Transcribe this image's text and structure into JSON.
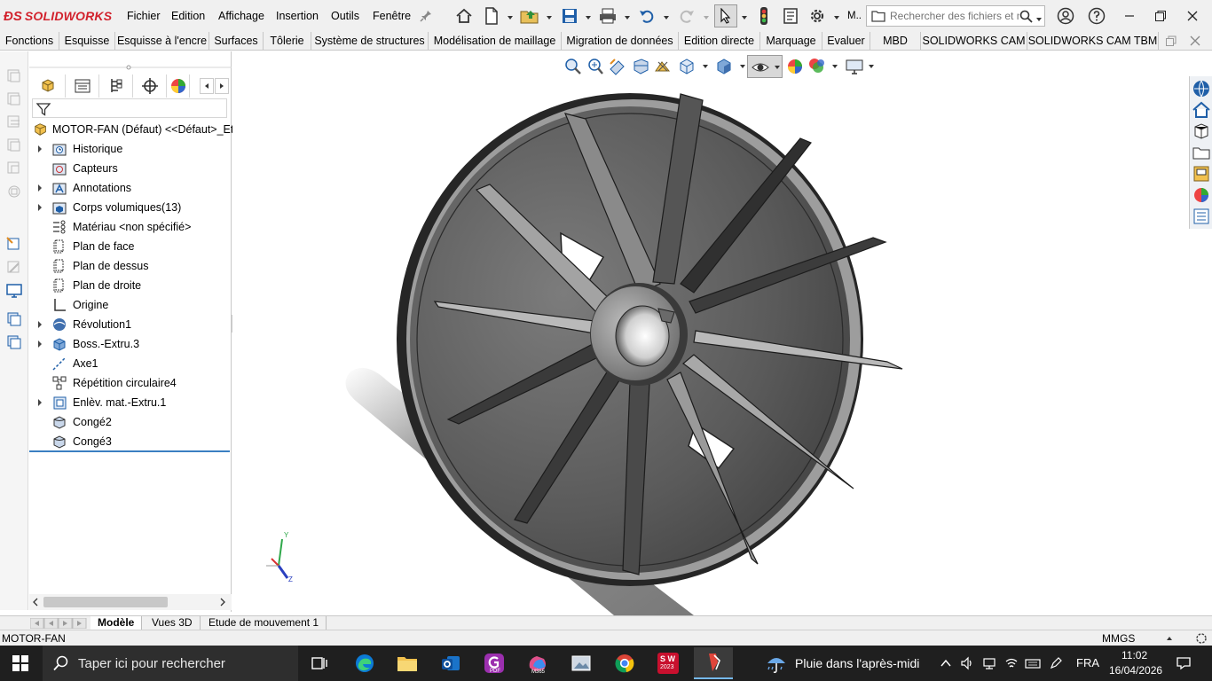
{
  "app": {
    "brand": "SOLIDWORKS",
    "brand_color": "#d2222d"
  },
  "menu": [
    "Fichier",
    "Edition",
    "Affichage",
    "Insertion",
    "Outils",
    "Fenêtre"
  ],
  "toolbar": {
    "user_abbrev": "M..",
    "search_placeholder": "Rechercher des fichiers et m"
  },
  "command_tabs": [
    "Fonctions",
    "Esquisse",
    "Esquisse à l'encre",
    "Surfaces",
    "Tôlerie",
    "Système de structures",
    "Modélisation de maillage",
    "Migration de données",
    "Edition directe",
    "Marquage",
    "Evaluer",
    "MBD",
    "SOLIDWORKS CAM",
    "SOLIDWORKS CAM TBM"
  ],
  "feature_tree": {
    "root": "MOTOR-FAN (Défaut) <<Défaut>_Etat",
    "items": [
      {
        "label": "Historique",
        "icon": "history-folder-icon",
        "expandable": true
      },
      {
        "label": "Capteurs",
        "icon": "sensor-icon",
        "expandable": false
      },
      {
        "label": "Annotations",
        "icon": "annotations-icon",
        "expandable": true
      },
      {
        "label": "Corps volumiques(13)",
        "icon": "solid-bodies-icon",
        "expandable": true
      },
      {
        "label": "Matériau <non spécifié>",
        "icon": "material-icon",
        "expandable": false
      },
      {
        "label": "Plan de face",
        "icon": "plane-icon",
        "expandable": false
      },
      {
        "label": "Plan de dessus",
        "icon": "plane-icon",
        "expandable": false
      },
      {
        "label": "Plan de droite",
        "icon": "plane-icon",
        "expandable": false
      },
      {
        "label": "Origine",
        "icon": "origin-icon",
        "expandable": false
      },
      {
        "label": "Révolution1",
        "icon": "revolve-icon",
        "expandable": true
      },
      {
        "label": "Boss.-Extru.3",
        "icon": "extrude-boss-icon",
        "expandable": true
      },
      {
        "label": "Axe1",
        "icon": "axis-icon",
        "expandable": false
      },
      {
        "label": "Répétition circulaire4",
        "icon": "circular-pattern-icon",
        "expandable": false
      },
      {
        "label": "Enlèv. mat.-Extru.1",
        "icon": "extrude-cut-icon",
        "expandable": true
      },
      {
        "label": "Congé2",
        "icon": "fillet-icon",
        "expandable": false
      },
      {
        "label": "Congé3",
        "icon": "fillet-icon",
        "expandable": false
      }
    ]
  },
  "triad": {
    "y": "Y",
    "z": "Z"
  },
  "bottom_tabs": [
    "Modèle",
    "Vues 3D",
    "Etude de mouvement 1"
  ],
  "status": {
    "left": "MOTOR-FAN",
    "units": "MMGS"
  },
  "taskbar": {
    "search_placeholder": "Taper ici pour rechercher",
    "weather": "Pluie dans l'après-midi",
    "language": "FRA",
    "time": "11:02",
    "date": "16/04/2026",
    "pdf_badge": "PDF",
    "m365_badge": "M365",
    "sw_badge_top": "S W",
    "sw_badge_bottom": "2023"
  }
}
